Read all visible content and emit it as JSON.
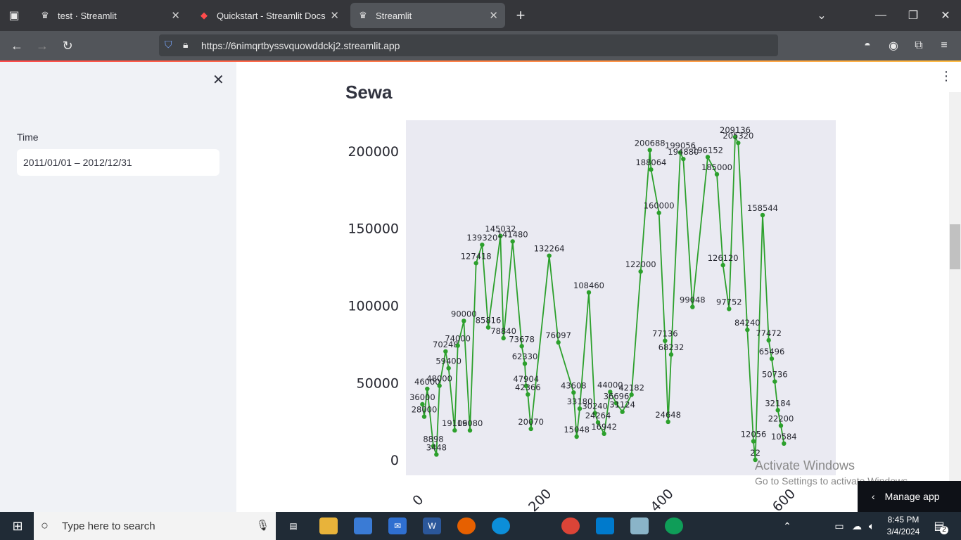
{
  "browser": {
    "tabs": [
      {
        "label": "test · Streamlit",
        "active": false
      },
      {
        "label": "Quickstart - Streamlit Docs",
        "active": false
      },
      {
        "label": "Streamlit",
        "active": true
      }
    ],
    "url": "https://6nimqrtbyssvquowddckj2.streamlit.app"
  },
  "sidebar": {
    "time_label": "Time",
    "time_value": "2011/01/01 – 2012/12/31"
  },
  "main": {
    "heading": "Sewa",
    "manage_app": "Manage app"
  },
  "watermark": {
    "line1": "Activate Windows",
    "line2": "Go to Settings to activate Windows."
  },
  "taskbar": {
    "search_placeholder": "Type here to search",
    "time": "8:45 PM",
    "date": "3/4/2024",
    "notifications": "2"
  },
  "chart_data": {
    "type": "line",
    "ylim": [
      -10000,
      220000
    ],
    "xlim": [
      -25,
      680
    ],
    "yticks": [
      0,
      50000,
      100000,
      150000,
      200000
    ],
    "xticks": [
      0,
      200,
      400,
      600
    ],
    "color": "#2ca02c",
    "background": "#eaeaf2",
    "labeled_points": [
      [
        2,
        36000
      ],
      [
        5,
        28000
      ],
      [
        10,
        46000
      ],
      [
        20,
        8898
      ],
      [
        25,
        3448
      ],
      [
        30,
        48000
      ],
      [
        40,
        70248
      ],
      [
        45,
        59400
      ],
      [
        55,
        19106
      ],
      [
        60,
        74000
      ],
      [
        70,
        90000
      ],
      [
        80,
        19080
      ],
      [
        90,
        127418
      ],
      [
        100,
        139320
      ],
      [
        110,
        85816
      ],
      [
        130,
        145032
      ],
      [
        135,
        78840
      ],
      [
        150,
        141480
      ],
      [
        165,
        73678
      ],
      [
        170,
        62330
      ],
      [
        172,
        47904
      ],
      [
        175,
        42366
      ],
      [
        180,
        20070
      ],
      [
        210,
        132264
      ],
      [
        225,
        76097
      ],
      [
        250,
        43608
      ],
      [
        255,
        15048
      ],
      [
        260,
        33180
      ],
      [
        275,
        108460
      ],
      [
        285,
        30240
      ],
      [
        290,
        24264
      ],
      [
        300,
        16942
      ],
      [
        310,
        44000
      ],
      [
        320,
        36696
      ],
      [
        330,
        31124
      ],
      [
        345,
        42182
      ],
      [
        360,
        122000
      ],
      [
        375,
        200688
      ],
      [
        377,
        188064
      ],
      [
        390,
        160000
      ],
      [
        400,
        77136
      ],
      [
        405,
        24648
      ],
      [
        410,
        68232
      ],
      [
        425,
        199056
      ],
      [
        430,
        194880
      ],
      [
        445,
        99048
      ],
      [
        470,
        196152
      ],
      [
        485,
        185000
      ],
      [
        495,
        126120
      ],
      [
        505,
        97752
      ],
      [
        515,
        209136
      ],
      [
        520,
        205320
      ],
      [
        535,
        84240
      ],
      [
        545,
        12056
      ],
      [
        548,
        22
      ],
      [
        560,
        158544
      ],
      [
        570,
        77472
      ],
      [
        575,
        65496
      ],
      [
        580,
        50736
      ],
      [
        585,
        32184
      ],
      [
        590,
        22200
      ],
      [
        595,
        10584
      ]
    ]
  }
}
